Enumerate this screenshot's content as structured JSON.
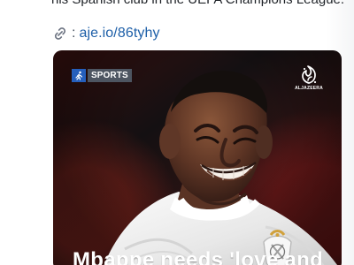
{
  "post": {
    "snippet": "his Spanish club in the UEFA Champions League.",
    "link": {
      "icon": "link-icon",
      "separator": ":",
      "text": "aje.io/86tyhy"
    }
  },
  "media": {
    "category": "SPORTS",
    "brand": "ALJAZEERA",
    "headline": "Mbappe needs 'love and",
    "colors": {
      "category_icon": "#255fbc",
      "category_label": "#4d5561",
      "link": "#1d5fa8"
    }
  }
}
